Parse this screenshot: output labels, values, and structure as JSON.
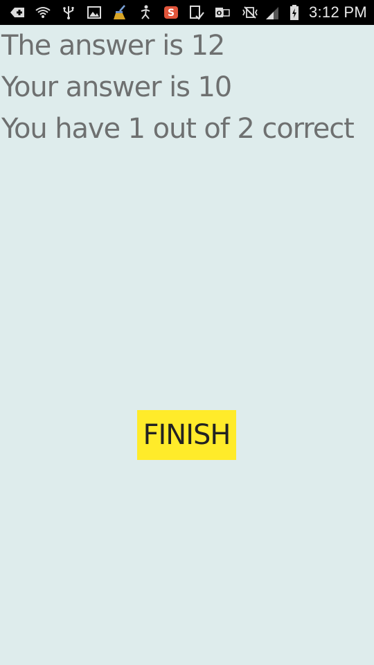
{
  "status_bar": {
    "time": "3:12 PM",
    "icons": [
      "add-notification-icon",
      "wifi-icon",
      "usb-icon",
      "gallery-icon",
      "cleaner-icon",
      "accessibility-icon",
      "app-s-icon",
      "download-complete-icon",
      "outlook-icon",
      "vibrate-mute-icon",
      "signal-icon",
      "battery-charging-icon"
    ]
  },
  "result": {
    "answer_line": "The answer is 12",
    "your_answer_line": "Your answer is 10",
    "score_line": "You have 1 out of 2 correct"
  },
  "finish_button": {
    "label": "FINISH",
    "color": "#ffeb2a"
  },
  "colors": {
    "background": "#deecec",
    "text": "#6e7070",
    "status_bar": "#000000"
  }
}
